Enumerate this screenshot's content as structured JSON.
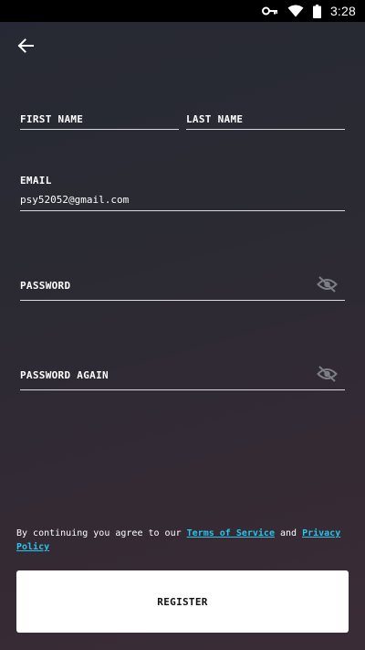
{
  "status_bar": {
    "time": "3:28",
    "icons": [
      "key-icon",
      "wifi-icon",
      "battery-icon"
    ]
  },
  "header": {
    "back_icon": "arrow-left-icon"
  },
  "form": {
    "first_name": {
      "label": "FIRST NAME",
      "value": ""
    },
    "last_name": {
      "label": "LAST NAME",
      "value": ""
    },
    "email": {
      "label": "EMAIL",
      "value": "psy52052@gmail.com"
    },
    "password": {
      "label": "PASSWORD",
      "value": "",
      "icon": "eye-off-icon"
    },
    "password_again": {
      "label": "PASSWORD AGAIN",
      "value": "",
      "icon": "eye-off-icon"
    }
  },
  "terms": {
    "prefix": "By continuing you agree to our ",
    "terms_link": "Terms of Service",
    "conjunction": " and ",
    "privacy_link": "Privacy Policy"
  },
  "register": {
    "label": "REGISTER"
  },
  "colors": {
    "link": "#29c4ea",
    "field_line": "#d9d9de",
    "button_bg": "#ffffff"
  }
}
